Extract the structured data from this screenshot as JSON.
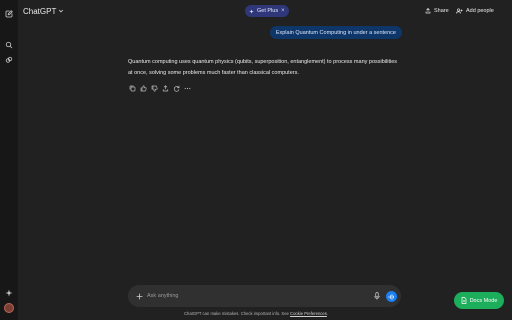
{
  "header": {
    "model_label": "ChatGPT",
    "plus_label": "Get Plus",
    "plus_close": "×",
    "share_label": "Share",
    "add_people_label": "Add people"
  },
  "sidebar": {
    "icons": [
      "new-chat-icon",
      "search-icon",
      "explore-icon",
      "sparkle-icon",
      "avatar"
    ]
  },
  "conversation": {
    "user_message": "Explain Quantum Computing in under a sentence",
    "assistant_message": "Quantum computing uses quantum physics (qubits, superposition, entanglement) to process many possibilities at once, solving some problems much faster than classical computers.",
    "actions": [
      "copy-icon",
      "thumbs-up-icon",
      "thumbs-down-icon",
      "share-icon",
      "regenerate-icon",
      "more-icon"
    ]
  },
  "composer": {
    "placeholder": "Ask anything"
  },
  "footer": {
    "text": "ChatGPT can make mistakes. Check important info. See ",
    "link": "Cookie Preferences",
    "end": "."
  },
  "docs_button": {
    "label": "Docs Mode"
  },
  "colors": {
    "background": "#212121",
    "sidebar": "#171717",
    "user_bubble": "#0e3668",
    "plus_pill": "#2f3778",
    "voice_button": "#1a7ff0",
    "docs_button": "#1cae5b"
  }
}
